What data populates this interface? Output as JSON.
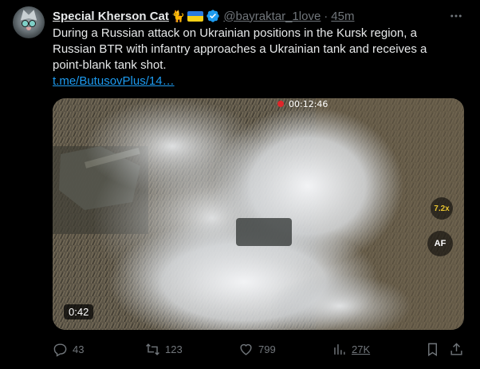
{
  "tweet": {
    "author_name": "Special Kherson Cat",
    "author_emoji": "🐈",
    "handle": "@bayraktar_1love",
    "separator": "·",
    "time": "45m",
    "text": "During a Russian attack on Ukrainian positions in the Kursk region, a Russian BTR with infantry approaches a Ukrainian tank and receives a point-blank tank shot.",
    "link": "t.me/ButusovPlus/14…"
  },
  "video": {
    "timestamp": "00:12:46",
    "zoom": "7.2x",
    "af_label": "AF",
    "duration": "0:42"
  },
  "actions": {
    "replies": "43",
    "reposts": "123",
    "likes": "799",
    "views": "27K"
  },
  "colors": {
    "background": "#000000",
    "text": "#e7e9ea",
    "muted": "#71767b",
    "accent": "#1d9bf0"
  },
  "icons": [
    "more-icon",
    "verified-badge-icon",
    "reply-icon",
    "repost-icon",
    "like-icon",
    "views-icon",
    "bookmark-icon",
    "share-icon"
  ]
}
